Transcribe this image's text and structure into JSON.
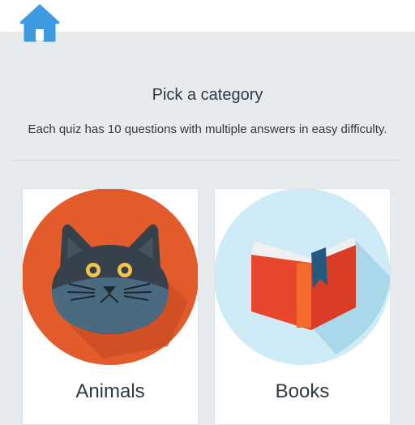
{
  "header": {
    "home_icon": "home-icon",
    "home_color": "#3d9be0"
  },
  "main": {
    "title": "Pick a category",
    "subtitle": "Each quiz has 10 questions with multiple answers in easy difficulty."
  },
  "categories": [
    {
      "label": "Animals",
      "icon": "cat-icon",
      "color": "#e35a2b"
    },
    {
      "label": "Books",
      "icon": "book-icon",
      "color": "#d0ebf8"
    }
  ]
}
